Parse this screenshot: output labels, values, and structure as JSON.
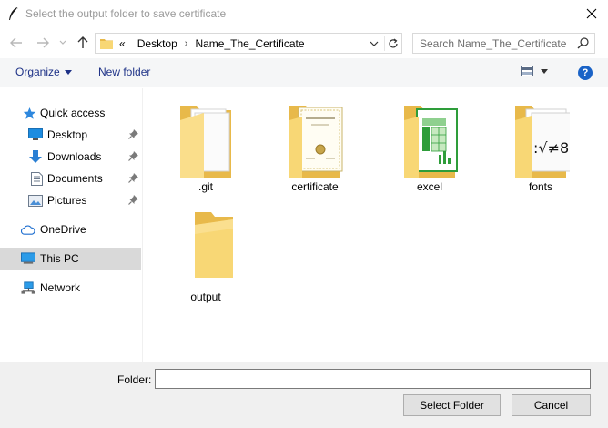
{
  "window": {
    "title": "Select the output folder to save certificate"
  },
  "navigation": {
    "breadcrumb_overflow": "«",
    "breadcrumbs": [
      "Desktop",
      "Name_The_Certificate"
    ],
    "search_placeholder": "Search Name_The_Certificate"
  },
  "toolbar": {
    "organize_label": "Organize",
    "new_folder_label": "New folder",
    "help_label": "?"
  },
  "sidebar": {
    "items": [
      {
        "label": "Quick access",
        "icon": "star-icon",
        "pinned": false
      },
      {
        "label": "Desktop",
        "icon": "desktop-icon",
        "pinned": true
      },
      {
        "label": "Downloads",
        "icon": "download-icon",
        "pinned": true
      },
      {
        "label": "Documents",
        "icon": "documents-icon",
        "pinned": true
      },
      {
        "label": "Pictures",
        "icon": "pictures-icon",
        "pinned": true
      },
      {
        "label": "OneDrive",
        "icon": "cloud-icon",
        "pinned": false
      },
      {
        "label": "This PC",
        "icon": "computer-icon",
        "pinned": false,
        "selected": true
      },
      {
        "label": "Network",
        "icon": "network-icon",
        "pinned": false
      }
    ]
  },
  "folders": [
    {
      "name": ".git",
      "icon": "folder-documents-icon"
    },
    {
      "name": "certificate",
      "icon": "folder-certificate-icon"
    },
    {
      "name": "excel",
      "icon": "folder-spreadsheet-icon"
    },
    {
      "name": "fonts",
      "icon": "folder-fonts-icon"
    },
    {
      "name": "output",
      "icon": "folder-empty-icon"
    }
  ],
  "footer": {
    "folder_label": "Folder:",
    "folder_value": "",
    "select_button": "Select Folder",
    "cancel_button": "Cancel"
  },
  "colors": {
    "accent": "#1a63c7",
    "folder_yellow": "#f8d775",
    "folder_dark": "#e8b94a",
    "selected_bg": "#d9d9d9",
    "command_bar_bg": "#f5f6f7",
    "footer_bg": "#f0f0f0"
  }
}
